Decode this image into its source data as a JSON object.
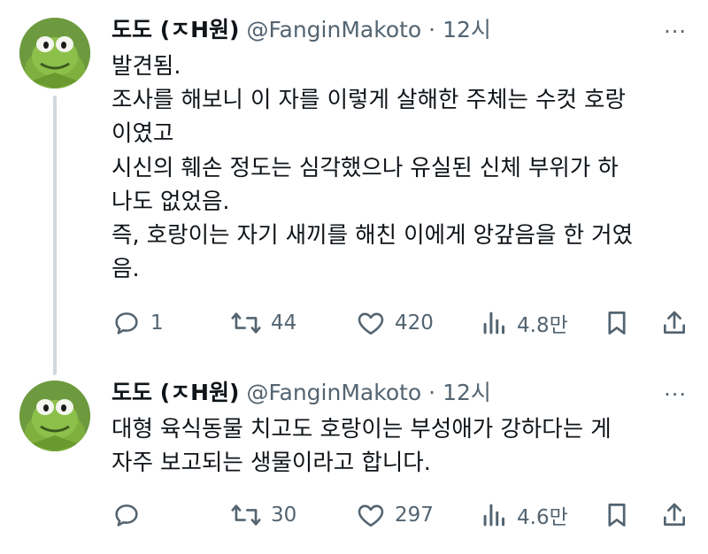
{
  "tweets": [
    {
      "author_name": "도도 (ㅈH원)",
      "handle": "@FanginMakoto",
      "separator": "·",
      "time": "12시",
      "more_label": "···",
      "lines": [
        "발견됨.",
        "조사를 해보니 이 자를 이렇게 살해한 주체는 수컷 호랑",
        "이였고",
        "시신의 훼손 정도는 심각했으나 유실된 신체 부위가 하",
        "나도 없었음.",
        "즉, 호랑이는 자기 새끼를 해친 이에게 앙갚음을 한 거였",
        "음."
      ],
      "replies": "1",
      "retweets": "44",
      "likes": "420",
      "views": "4.8만"
    },
    {
      "author_name": "도도 (ㅈH원)",
      "handle": "@FanginMakoto",
      "separator": "·",
      "time": "12시",
      "more_label": "···",
      "lines": [
        "대형 육식동물 치고도 호랑이는 부성애가 강하다는 게",
        "자주 보고되는 생물이라고 합니다."
      ],
      "replies": "",
      "retweets": "30",
      "likes": "297",
      "views": "4.6만"
    }
  ],
  "icons": {
    "reply": "reply-icon",
    "retweet": "retweet-icon",
    "like": "heart-icon",
    "views": "views-icon",
    "bookmark": "bookmark-icon",
    "share": "share-icon"
  },
  "colors": {
    "text": "#0f1419",
    "muted": "#536471",
    "thread_line": "#cfd9de"
  }
}
